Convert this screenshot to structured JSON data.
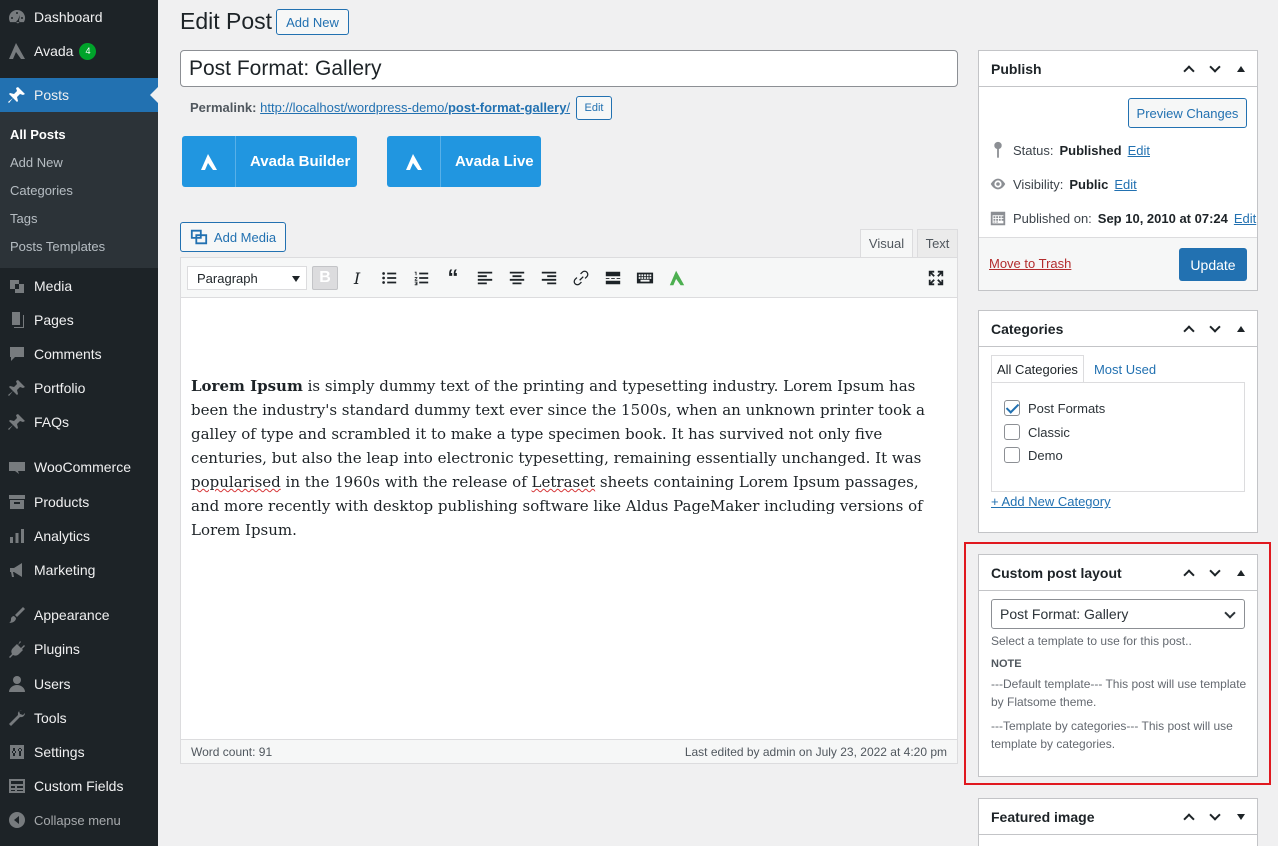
{
  "sidebar": {
    "top_items": [
      {
        "label": "Dashboard",
        "icon": "dashboard-icon"
      },
      {
        "label": "Avada",
        "icon": "avada-icon",
        "badge": "4"
      },
      {
        "label": "Posts",
        "icon": "pin-icon"
      }
    ],
    "submenu": [
      {
        "label": "All Posts"
      },
      {
        "label": "Add New"
      },
      {
        "label": "Categories"
      },
      {
        "label": "Tags"
      },
      {
        "label": "Posts Templates"
      }
    ],
    "items": [
      {
        "label": "Media"
      },
      {
        "label": "Pages"
      },
      {
        "label": "Comments"
      },
      {
        "label": "Portfolio"
      },
      {
        "label": "FAQs"
      },
      {
        "label": "WooCommerce"
      },
      {
        "label": "Products"
      },
      {
        "label": "Analytics"
      },
      {
        "label": "Marketing"
      },
      {
        "label": "Appearance"
      },
      {
        "label": "Plugins"
      },
      {
        "label": "Users"
      },
      {
        "label": "Tools"
      },
      {
        "label": "Settings"
      },
      {
        "label": "Custom Fields"
      }
    ],
    "collapse_label": "Collapse menu"
  },
  "header": {
    "title": "Edit Post",
    "add_new": "Add New"
  },
  "post": {
    "title": "Post Format: Gallery",
    "permalink_label": "Permalink:",
    "permalink_base": "http://localhost/wordpress-demo/",
    "permalink_slug": "post-format-gallery",
    "permalink_tail": "/",
    "edit_label": "Edit"
  },
  "avada_buttons": {
    "builder": "Avada Builder",
    "live": "Avada Live"
  },
  "editor": {
    "add_media": "Add Media",
    "tab_visual": "Visual",
    "tab_text": "Text",
    "format": "Paragraph",
    "bold_word": "Lorem Ipsum",
    "paragraph_a": " is simply dummy text of the printing and typesetting industry. Lorem Ipsum has been the industry's standard dummy text ever since the 1500s, when an unknown printer took a galley of type and scrambled it to make a type specimen book. It has survived not only five centuries, but also the leap into electronic typesetting, remaining essentially unchanged. It was ",
    "spell_1": "popularised",
    "paragraph_b": " in the 1960s with the release of ",
    "spell_2": "Letraset",
    "paragraph_c": " sheets containing Lorem Ipsum passages, and more recently with desktop publishing software like Aldus PageMaker including versions of Lorem Ipsum.",
    "word_count": "Word count: 91",
    "last_edited": "Last edited by admin on July 23, 2022 at 4:20 pm"
  },
  "publish": {
    "title": "Publish",
    "preview": "Preview Changes",
    "status_label": "Status:",
    "status_value": "Published",
    "visibility_label": "Visibility:",
    "visibility_value": "Public",
    "published_label": "Published on:",
    "published_value": "Sep 10, 2010 at 07:24",
    "edit": "Edit",
    "trash": "Move to Trash",
    "update": "Update"
  },
  "categories": {
    "title": "Categories",
    "tab_all": "All Categories",
    "tab_most": "Most Used",
    "items": [
      {
        "label": "Post Formats",
        "checked": true
      },
      {
        "label": "Classic",
        "checked": false
      },
      {
        "label": "Demo",
        "checked": false
      }
    ],
    "add_new": "+ Add New Category"
  },
  "custom_layout": {
    "title": "Custom post layout",
    "selected": "Post Format: Gallery",
    "help": "Select a template to use for this post..",
    "note": "NOTE",
    "note_1": "---Default template--- This post will use template by Flatsome theme.",
    "note_2": "---Template by categories--- This post will use template by categories."
  },
  "featured_image": {
    "title": "Featured image"
  },
  "colors": {
    "accent": "#2271b1",
    "sidebar_bg": "#1d2327",
    "avada_blue": "#2196e0",
    "highlight": "#e0181f"
  }
}
